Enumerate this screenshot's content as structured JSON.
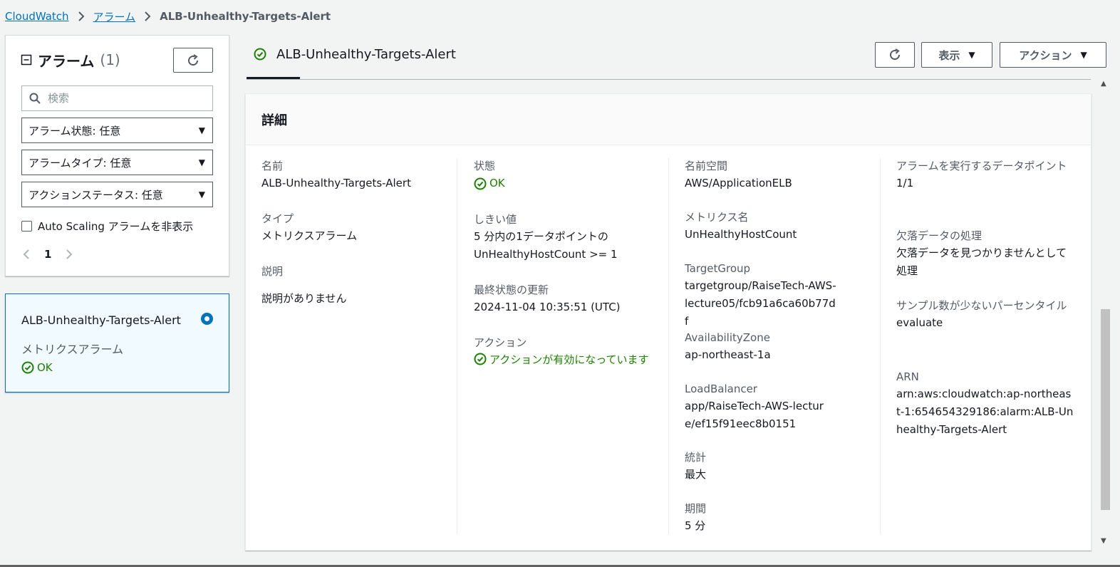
{
  "breadcrumb": {
    "items": [
      "CloudWatch",
      "アラーム"
    ],
    "current": "ALB-Unhealthy-Targets-Alert"
  },
  "left_panel": {
    "title": "アラーム",
    "count": "(1)",
    "search_placeholder": "検索",
    "filters": [
      "アラーム状態: 任意",
      "アラームタイプ: 任意",
      "アクションステータス: 任意"
    ],
    "checkbox_label": "Auto Scaling アラームを非表示",
    "page": "1"
  },
  "alarm_card": {
    "name": "ALB-Unhealthy-Targets-Alert",
    "type": "メトリクスアラーム",
    "state": "OK"
  },
  "header": {
    "title": "ALB-Unhealthy-Targets-Alert",
    "view_label": "表示",
    "actions_label": "アクション"
  },
  "details": {
    "title": "詳細",
    "col1": [
      {
        "label": "名前",
        "value": "ALB-Unhealthy-Targets-Alert"
      },
      {
        "label": "タイプ",
        "value": "メトリクスアラーム"
      },
      {
        "label": "説明",
        "value": "説明がありません"
      }
    ],
    "col2": {
      "state_label": "状態",
      "state_value": "OK",
      "threshold_label": "しきい値",
      "threshold_value": "5 分内の1データポイントの UnHealthyHostCount >= 1",
      "last_update_label": "最終状態の更新",
      "last_update_value": "2024-11-04 10:35:51 (UTC)",
      "actions_label": "アクション",
      "actions_value": "アクションが有効になっています"
    },
    "col3": [
      {
        "label": "名前空間",
        "value": "AWS/ApplicationELB"
      },
      {
        "label": "メトリクス名",
        "value": "UnHealthyHostCount"
      },
      {
        "label": "TargetGroup",
        "value": "targetgroup/RaiseTech-AWS-lecture05/fcb91a6ca60b77df"
      },
      {
        "label": "AvailabilityZone",
        "value": "ap-northeast-1a"
      },
      {
        "label": "LoadBalancer",
        "value": "app/RaiseTech-AWS-lecture/ef15f91eec8b0151"
      },
      {
        "label": "統計",
        "value": "最大"
      },
      {
        "label": "期間",
        "value": "5 分"
      }
    ],
    "col4": [
      {
        "label": "アラームを実行するデータポイント",
        "value": "1/1"
      },
      {
        "label": "欠落データの処理",
        "value": "欠落データを見つかりませんとして処理"
      },
      {
        "label": "サンプル数が少ないパーセンタイル",
        "value": "evaluate"
      },
      {
        "label": "ARN",
        "value": "arn:aws:cloudwatch:ap-northeast-1:654654329186:alarm:ALB-Unhealthy-Targets-Alert"
      }
    ]
  },
  "colors": {
    "link": "#0073bb",
    "ok_green": "#1d8102",
    "selected_bg": "#f1faff"
  }
}
